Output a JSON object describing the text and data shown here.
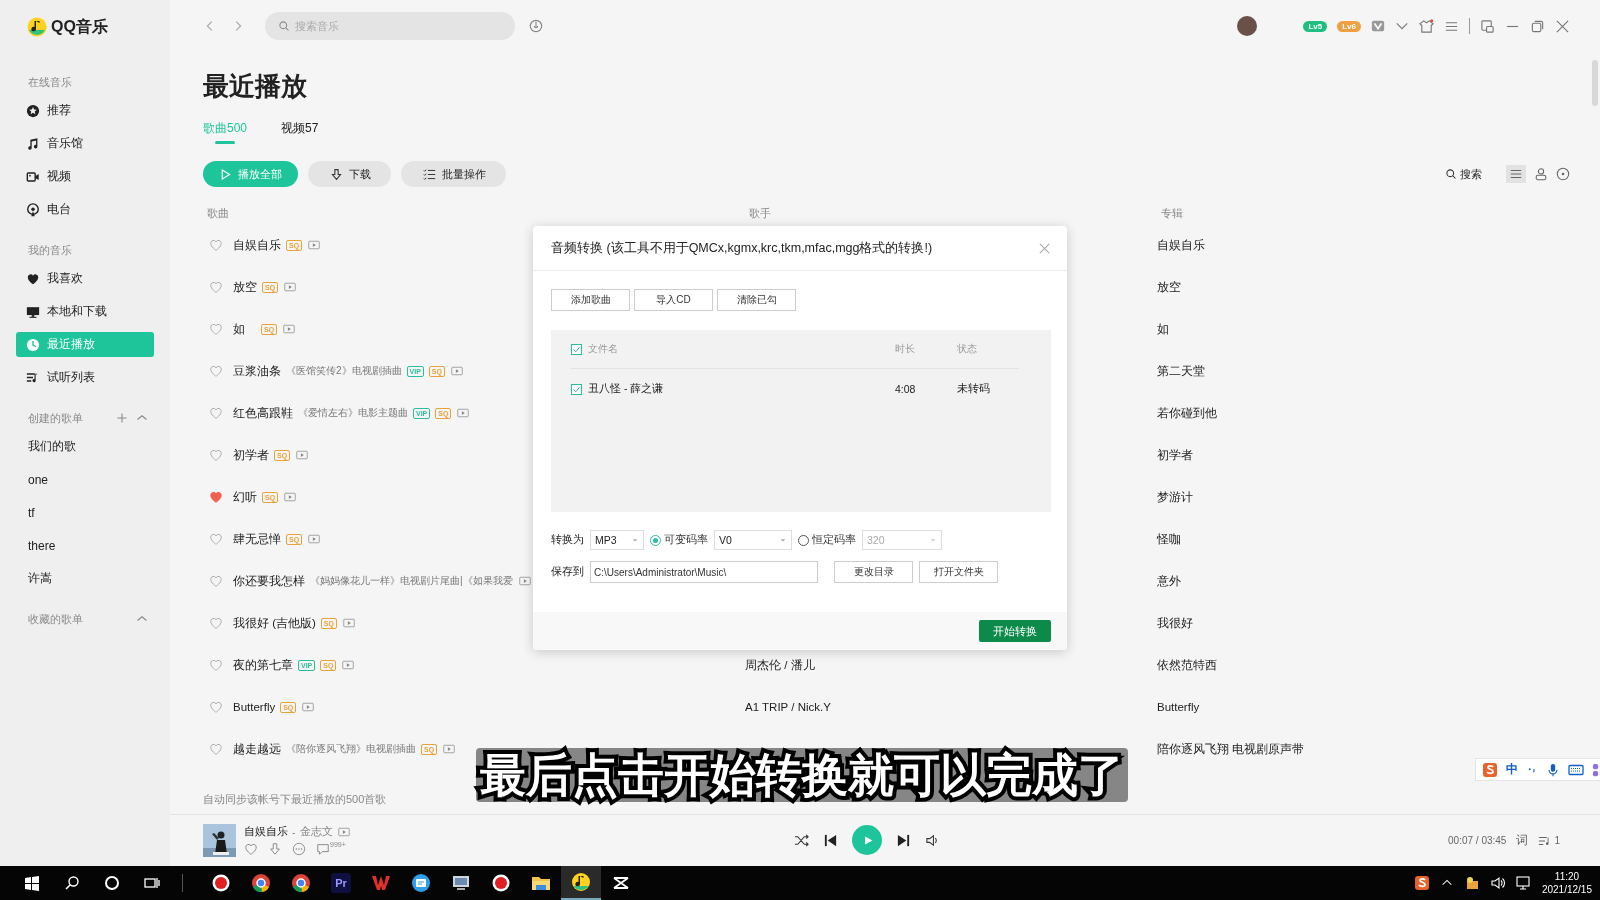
{
  "app": {
    "logo": "QQ音乐"
  },
  "sidebar": {
    "sections": [
      {
        "title": "在线音乐",
        "items": [
          {
            "label": "推荐",
            "selected": false
          },
          {
            "label": "音乐馆",
            "selected": false
          },
          {
            "label": "视频",
            "selected": false
          },
          {
            "label": "电台",
            "selected": false
          }
        ]
      },
      {
        "title": "我的音乐",
        "items": [
          {
            "label": "我喜欢",
            "selected": false
          },
          {
            "label": "本地和下载",
            "selected": false
          },
          {
            "label": "最近播放",
            "selected": true
          },
          {
            "label": "试听列表",
            "selected": false
          }
        ]
      },
      {
        "title": "创建的歌单",
        "kind": "created",
        "items": [
          {
            "label": "我们的歌",
            "selected": false
          },
          {
            "label": "one",
            "selected": false
          },
          {
            "label": "tf",
            "selected": false
          },
          {
            "label": "there",
            "selected": false
          },
          {
            "label": "许嵩",
            "selected": false
          }
        ]
      },
      {
        "title": "收藏的歌单",
        "kind": "collected"
      }
    ]
  },
  "search": {
    "placeholder": "搜索音乐"
  },
  "account": {
    "badges": [
      {
        "label": "Lv5",
        "color": "#1fbf7f"
      },
      {
        "label": "Lv6",
        "color": "#f0a040"
      }
    ]
  },
  "page": {
    "title": "最近播放",
    "tabs": [
      {
        "label": "歌曲500",
        "selected": true
      },
      {
        "label": "视频57",
        "selected": false
      }
    ],
    "actions": [
      {
        "label": "播放全部",
        "kind": "primary"
      },
      {
        "label": "下载",
        "kind": "download"
      },
      {
        "label": "批量操作",
        "kind": "batch"
      }
    ],
    "list_search": "搜索"
  },
  "table": {
    "columns": [
      "歌曲",
      "歌手",
      "专辑"
    ],
    "rows": [
      {
        "title": "自娱自乐",
        "tags": [
          {
            "label": "SQ",
            "color": "#e8a23a"
          }
        ],
        "liked": false,
        "album": "自娱自乐"
      },
      {
        "title": "放空",
        "tags": [
          {
            "label": "SQ",
            "color": "#e8a23a"
          }
        ],
        "liked": false,
        "album": "放空"
      },
      {
        "title": "如",
        "tags": [
          {
            "label": "SQ",
            "color": "#e8a23a"
          }
        ],
        "liked": false,
        "album": "如"
      },
      {
        "title": "豆浆油条",
        "note": "《医馆笑传2》电视剧插曲",
        "tags": [
          {
            "label": "VIP",
            "color": "#2bbd9e"
          },
          {
            "label": "SQ",
            "color": "#e8a23a"
          }
        ],
        "liked": false,
        "album": "第二天堂"
      },
      {
        "title": "红色高跟鞋",
        "note": "《爱情左右》电影主题曲",
        "tags": [
          {
            "label": "VIP",
            "color": "#2bbd9e"
          },
          {
            "label": "SQ",
            "color": "#e8a23a"
          }
        ],
        "liked": false,
        "album": "若你碰到他"
      },
      {
        "title": "初学者",
        "tags": [
          {
            "label": "SQ",
            "color": "#e8a23a"
          }
        ],
        "liked": false,
        "album": "初学者"
      },
      {
        "title": "幻听",
        "tags": [
          {
            "label": "SQ",
            "color": "#e8a23a"
          }
        ],
        "liked": true,
        "album": "梦游计"
      },
      {
        "title": "肆无忌惮",
        "tags": [
          {
            "label": "SQ",
            "color": "#e8a23a"
          }
        ],
        "liked": false,
        "album": "怪咖"
      },
      {
        "title": "你还要我怎样",
        "note": "《妈妈像花儿一样》电视剧片尾曲|《如果我爱",
        "liked": false,
        "album": "意外"
      },
      {
        "title": "我很好 (吉他版)",
        "tags": [
          {
            "label": "SQ",
            "color": "#e8a23a"
          }
        ],
        "liked": false,
        "album": "我很好"
      },
      {
        "title": "夜的第七章",
        "tags": [
          {
            "label": "VIP",
            "color": "#2bbd9e"
          },
          {
            "label": "SQ",
            "color": "#e8a23a"
          }
        ],
        "liked": false,
        "singer": "周杰伦 / 潘儿",
        "album": "依然范特西"
      },
      {
        "title": "Butterfly",
        "tags": [
          {
            "label": "SQ",
            "color": "#e8a23a"
          }
        ],
        "liked": false,
        "singer": "A1 TRIP / Nick.Y",
        "album": "Butterfly"
      },
      {
        "title": "越走越远",
        "note": "《陪你逐风飞翔》电视剧插曲",
        "tags": [
          {
            "label": "SQ",
            "color": "#e8a23a"
          }
        ],
        "liked": false,
        "album": "陪你逐风飞翔 电视剧原声带"
      }
    ],
    "footer_note": "自动同步该帐号下最近播放的500首歌"
  },
  "dialog": {
    "title": "音频转换 (该工具不用于QMCx,kgmx,krc,tkm,mfac,mgg格式的转换!)",
    "buttons": [
      "添加歌曲",
      "导入CD",
      "清除已勾"
    ],
    "file_table": {
      "all_checked": true,
      "columns": [
        "文件名",
        "时长",
        "状态"
      ],
      "rows": [
        {
          "name": "丑八怪 - 薛之谦",
          "duration": "4:08",
          "status": "未转码",
          "checked": true
        }
      ]
    },
    "convert_label": "转换为",
    "format": "MP3",
    "bitrate_modes": [
      {
        "label": "可变码率",
        "selected": true,
        "value": "V0"
      },
      {
        "label": "恒定码率",
        "selected": false,
        "value": "320"
      }
    ],
    "save_label": "保存到",
    "save_path": "C:\\Users\\Administrator\\Music\\",
    "save_buttons": [
      "更改目录",
      "打开文件夹"
    ],
    "start_button": "开始转换"
  },
  "player": {
    "title": "自娱自乐",
    "separator": "-",
    "artist": "金志文",
    "comment_count": "999+",
    "time": "00:07 / 03:45",
    "lyrics": "词",
    "queue_count": "1"
  },
  "caption": "最后点击开始转换就可以完成了",
  "ime": {
    "mode": "中"
  },
  "taskbar": {
    "apps": [
      {
        "kind": "record",
        "selected": false
      },
      {
        "kind": "browser",
        "selected": false
      },
      {
        "kind": "browser",
        "selected": false
      },
      {
        "kind": "editor",
        "label": "Pr",
        "selected": false
      },
      {
        "kind": "office",
        "selected": false
      },
      {
        "kind": "chat",
        "selected": false
      },
      {
        "kind": "monitor",
        "selected": false
      },
      {
        "kind": "record",
        "selected": false
      },
      {
        "kind": "folder",
        "selected": false
      },
      {
        "kind": "music",
        "selected": true
      },
      {
        "kind": "cut",
        "selected": false
      }
    ],
    "time": "11:20",
    "date": "2021/12/15"
  }
}
